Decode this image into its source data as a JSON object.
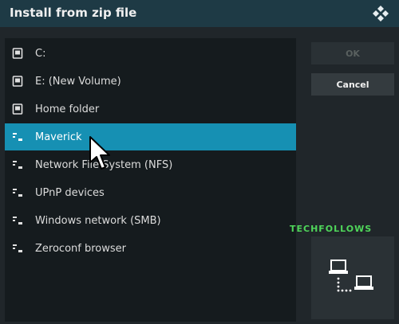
{
  "dialog": {
    "title": "Install from zip file"
  },
  "list": {
    "items": [
      {
        "label": "C:",
        "icon": "drive-icon",
        "selected": false
      },
      {
        "label": "E: (New Volume)",
        "icon": "drive-icon",
        "selected": false
      },
      {
        "label": "Home folder",
        "icon": "drive-icon",
        "selected": false
      },
      {
        "label": "Maverick",
        "icon": "network-share-icon",
        "selected": true
      },
      {
        "label": "Network File System (NFS)",
        "icon": "network-share-icon",
        "selected": false
      },
      {
        "label": "UPnP devices",
        "icon": "network-share-icon",
        "selected": false
      },
      {
        "label": "Windows network (SMB)",
        "icon": "network-share-icon",
        "selected": false
      },
      {
        "label": "Zeroconf browser",
        "icon": "network-share-icon",
        "selected": false
      }
    ]
  },
  "buttons": {
    "ok_label": "OK",
    "cancel_label": "Cancel"
  },
  "watermark": "TECHFOLLOWS",
  "colors": {
    "accent": "#1690b3",
    "titlebar": "#1e3a45",
    "watermark": "#4fd65a"
  }
}
